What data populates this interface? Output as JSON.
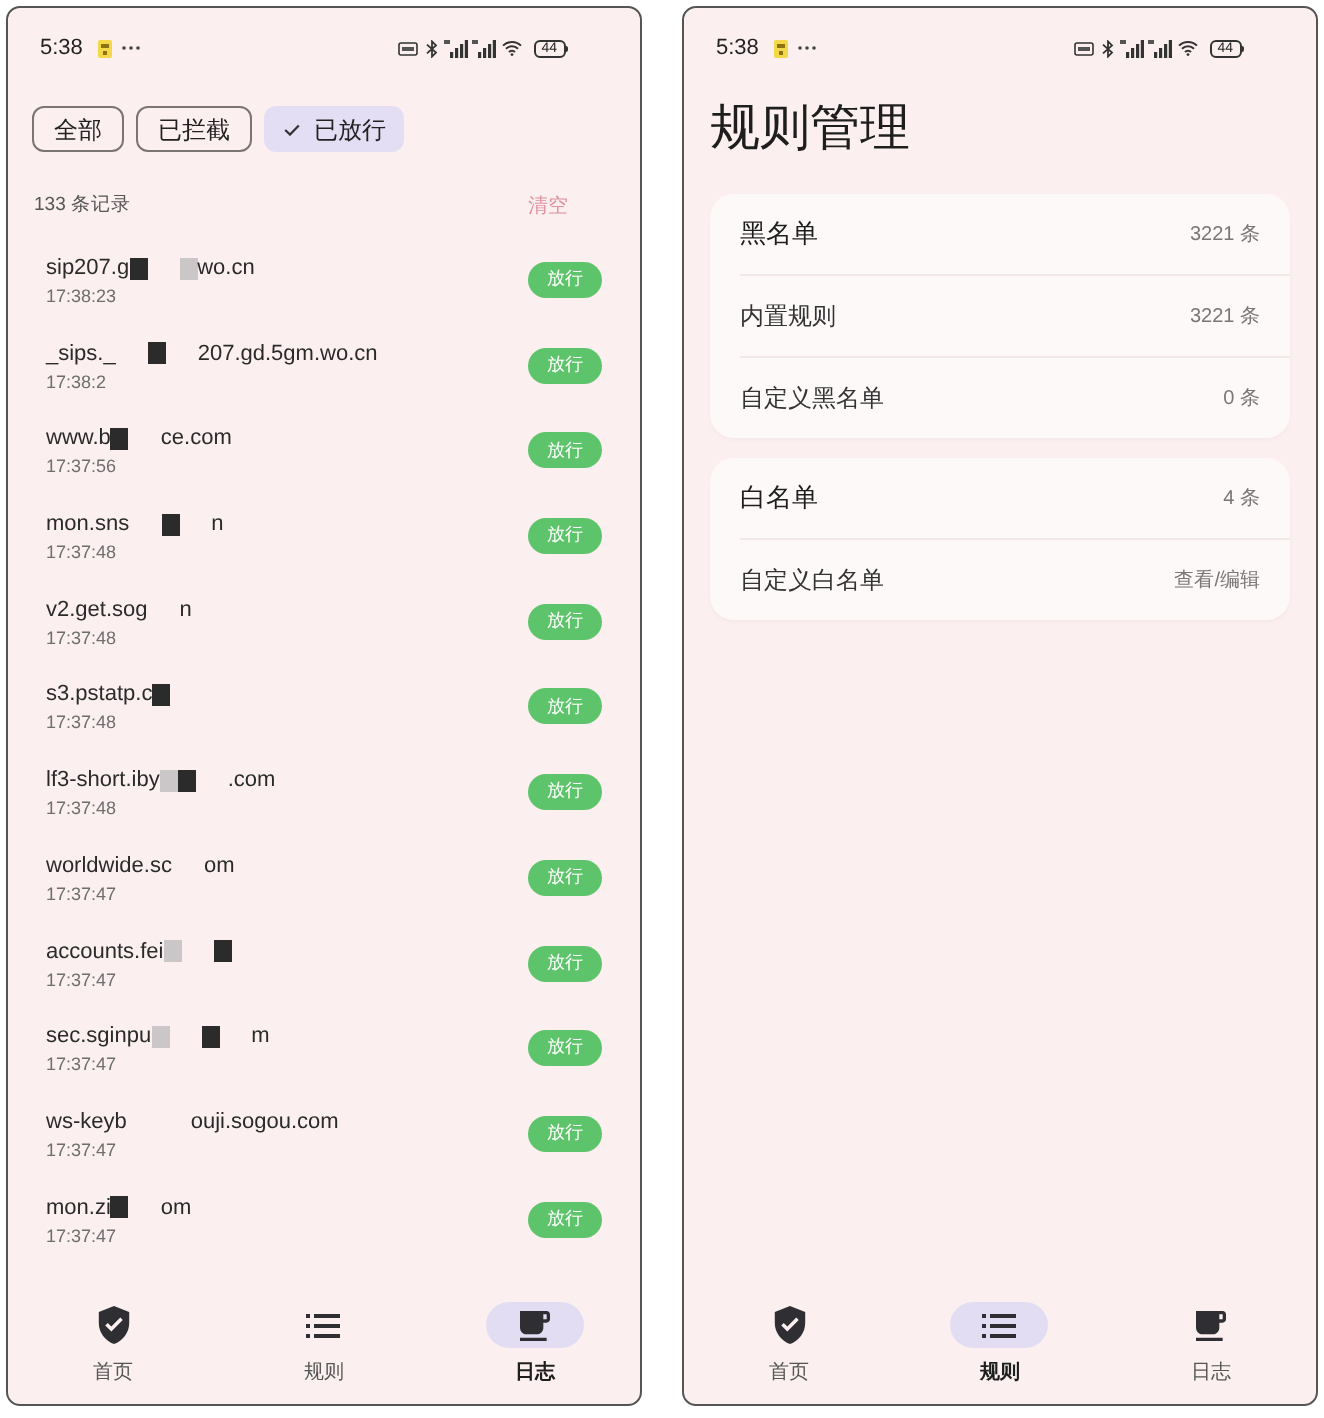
{
  "log_screen": {
    "status_bar": {
      "time": "5:38",
      "battery": "44"
    },
    "filters": [
      {
        "label": "全部",
        "selected": false
      },
      {
        "label": "已拦截",
        "selected": false
      },
      {
        "label": "已放行",
        "selected": true
      }
    ],
    "summary": {
      "count": "133 条记录",
      "action": "清空"
    },
    "records": [
      {
        "segments": [
          {
            "kind": "text",
            "text": "sip207.g"
          },
          {
            "kind": "dark"
          },
          {
            "kind": "gap"
          },
          {
            "kind": "light"
          },
          {
            "kind": "text",
            "text": "wo.cn"
          }
        ],
        "time": "17:38:23",
        "status": "放行"
      },
      {
        "segments": [
          {
            "kind": "text",
            "text": "_sips._"
          },
          {
            "kind": "gap"
          },
          {
            "kind": "dark"
          },
          {
            "kind": "gap"
          },
          {
            "kind": "text",
            "text": "207.gd.5gm.wo.cn"
          }
        ],
        "time": "17:38:2",
        "status": "放行"
      },
      {
        "segments": [
          {
            "kind": "text",
            "text": "www.b"
          },
          {
            "kind": "dark"
          },
          {
            "kind": "gap"
          },
          {
            "kind": "text",
            "text": "ce.com"
          }
        ],
        "time": "17:37:56",
        "status": "放行"
      },
      {
        "segments": [
          {
            "kind": "text",
            "text": "mon.sns"
          },
          {
            "kind": "gap"
          },
          {
            "kind": "dark"
          },
          {
            "kind": "gap"
          },
          {
            "kind": "text",
            "text": "n"
          }
        ],
        "time": "17:37:48",
        "status": "放行"
      },
      {
        "segments": [
          {
            "kind": "text",
            "text": "v2.get.sog"
          },
          {
            "kind": "gap"
          },
          {
            "kind": "text",
            "text": "n"
          }
        ],
        "time": "17:37:48",
        "status": "放行"
      },
      {
        "segments": [
          {
            "kind": "text",
            "text": "s3.pstatp.c"
          },
          {
            "kind": "dark"
          }
        ],
        "time": "17:37:48",
        "status": "放行"
      },
      {
        "segments": [
          {
            "kind": "text",
            "text": "lf3-short.iby"
          },
          {
            "kind": "light"
          },
          {
            "kind": "dark"
          },
          {
            "kind": "gap"
          },
          {
            "kind": "text",
            "text": ".com"
          }
        ],
        "time": "17:37:48",
        "status": "放行"
      },
      {
        "segments": [
          {
            "kind": "text",
            "text": "worldwide.sc"
          },
          {
            "kind": "gap"
          },
          {
            "kind": "text",
            "text": "om"
          }
        ],
        "time": "17:37:47",
        "status": "放行"
      },
      {
        "segments": [
          {
            "kind": "text",
            "text": "accounts.fei"
          },
          {
            "kind": "light"
          },
          {
            "kind": "gap"
          },
          {
            "kind": "dark"
          }
        ],
        "time": "17:37:47",
        "status": "放行"
      },
      {
        "segments": [
          {
            "kind": "text",
            "text": "sec.sginpu"
          },
          {
            "kind": "light"
          },
          {
            "kind": "gap"
          },
          {
            "kind": "dark"
          },
          {
            "kind": "gap"
          },
          {
            "kind": "text",
            "text": "m"
          }
        ],
        "time": "17:37:47",
        "status": "放行"
      },
      {
        "segments": [
          {
            "kind": "text",
            "text": "ws-keyb"
          },
          {
            "kind": "gap"
          },
          {
            "kind": "gap"
          },
          {
            "kind": "text",
            "text": "ouji.sogou.com"
          }
        ],
        "time": "17:37:47",
        "status": "放行"
      },
      {
        "segments": [
          {
            "kind": "text",
            "text": "mon.zi"
          },
          {
            "kind": "dark"
          },
          {
            "kind": "gap"
          },
          {
            "kind": "text",
            "text": "om"
          }
        ],
        "time": "17:37:47",
        "status": "放行"
      }
    ],
    "nav": [
      {
        "label": "首页",
        "selected": false
      },
      {
        "label": "规则",
        "selected": false
      },
      {
        "label": "日志",
        "selected": true
      }
    ]
  },
  "rules_screen": {
    "status_bar": {
      "time": "5:38",
      "battery": "44"
    },
    "title": "规则管理",
    "groups": [
      {
        "rows": [
          {
            "kind": "total",
            "label": "黑名单",
            "value": "3221 条"
          },
          {
            "kind": "entry",
            "label": "内置规则",
            "value": "3221 条"
          },
          {
            "kind": "entry",
            "label": "自定义黑名单",
            "value": "0 条"
          }
        ]
      },
      {
        "rows": [
          {
            "kind": "total",
            "label": "白名单",
            "value": "4 条"
          },
          {
            "kind": "entry",
            "label": "自定义白名单",
            "value": "查看/编辑"
          }
        ]
      }
    ],
    "nav": [
      {
        "label": "首页",
        "selected": false
      },
      {
        "label": "规则",
        "selected": true
      },
      {
        "label": "日志",
        "selected": false
      }
    ]
  }
}
